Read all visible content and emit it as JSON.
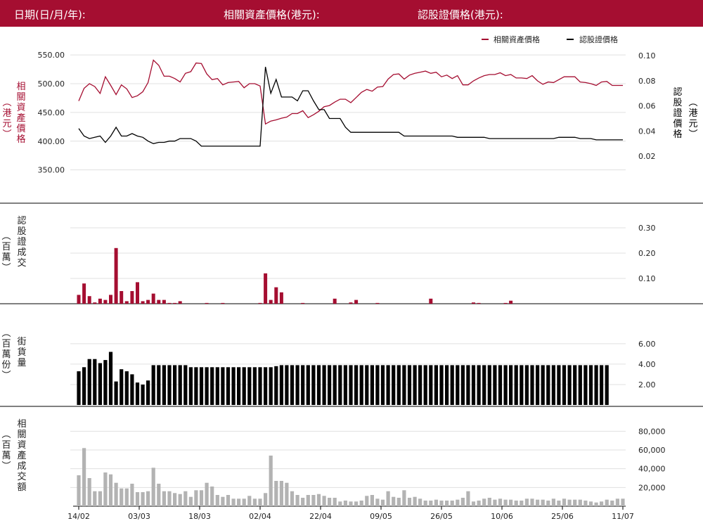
{
  "header": {
    "date_label": "日期(日/月/年):",
    "asset_price_label": "相關資產價格(港元):",
    "warrant_price_label": "認股證價格(港元):"
  },
  "colors": {
    "brand": "#a50e31",
    "warrant": "#000000",
    "turnover_grey": "#b3b3b3",
    "grid": "#e0e0e0"
  },
  "chart_data": [
    {
      "type": "line",
      "legend": [
        "相關資產價格",
        "認股證價格"
      ],
      "legend_position": "top-right",
      "x_ticks": [
        "14/02",
        "03/03",
        "18/03",
        "02/04",
        "22/04",
        "09/05",
        "26/05",
        "10/06",
        "25/06",
        "11/07"
      ],
      "ylabel_left": "相關資產價格(港元)",
      "ylabel_right": "認股證價格(港元)",
      "y_left_ticks": [
        "550.00",
        "500.00",
        "450.00",
        "400.00",
        "350.00"
      ],
      "y_right_ticks": [
        "0.10",
        "0.08",
        "0.06",
        "0.04",
        "0.02"
      ],
      "ylim_left": [
        330,
        560
      ],
      "ylim_right": [
        0,
        0.105
      ],
      "series": [
        {
          "name": "相關資產價格",
          "axis": "left",
          "color": "#a50e31",
          "values": [
            470,
            492,
            500,
            495,
            483,
            512,
            497,
            481,
            498,
            491,
            476,
            479,
            486,
            502,
            541,
            532,
            513,
            513,
            509,
            503,
            518,
            521,
            536,
            535,
            517,
            507,
            509,
            498,
            502,
            503,
            504,
            493,
            500,
            500,
            496,
            430,
            435,
            437,
            440,
            442,
            448,
            448,
            453,
            441,
            446,
            452,
            460,
            462,
            468,
            473,
            473,
            467,
            476,
            485,
            490,
            487,
            494,
            495,
            508,
            516,
            517,
            508,
            515,
            518,
            520,
            522,
            518,
            520,
            512,
            515,
            509,
            514,
            498,
            498,
            505,
            510,
            514,
            516,
            516,
            519,
            514,
            516,
            510,
            510,
            509,
            514,
            505,
            499,
            503,
            502,
            507,
            512,
            512,
            512,
            503,
            502,
            500,
            497,
            503,
            504,
            497,
            497,
            497
          ]
        },
        {
          "name": "認股證價格",
          "axis": "right",
          "color": "#000000",
          "values": [
            0.042,
            0.036,
            0.034,
            0.035,
            0.036,
            0.031,
            0.036,
            0.043,
            0.036,
            0.036,
            0.038,
            0.036,
            0.035,
            0.032,
            0.03,
            0.031,
            0.031,
            0.032,
            0.032,
            0.034,
            0.034,
            0.034,
            0.032,
            0.028,
            0.028,
            0.028,
            0.028,
            0.028,
            0.028,
            0.028,
            0.028,
            0.028,
            0.028,
            0.028,
            0.028,
            0.091,
            0.07,
            0.081,
            0.067,
            0.067,
            0.067,
            0.064,
            0.072,
            0.072,
            0.064,
            0.057,
            0.057,
            0.05,
            0.05,
            0.05,
            0.043,
            0.039,
            0.039,
            0.039,
            0.039,
            0.039,
            0.039,
            0.039,
            0.039,
            0.039,
            0.039,
            0.036,
            0.036,
            0.036,
            0.036,
            0.036,
            0.036,
            0.036,
            0.036,
            0.036,
            0.036,
            0.035,
            0.035,
            0.035,
            0.035,
            0.035,
            0.035,
            0.034,
            0.034,
            0.034,
            0.034,
            0.034,
            0.034,
            0.034,
            0.034,
            0.034,
            0.034,
            0.034,
            0.034,
            0.034,
            0.035,
            0.035,
            0.035,
            0.035,
            0.034,
            0.034,
            0.034,
            0.033,
            0.033,
            0.033,
            0.033,
            0.033,
            0.033
          ]
        }
      ]
    },
    {
      "type": "bar",
      "ylabel": "認股證成交(百萬)",
      "y_ticks": [
        "0.30",
        "0.20",
        "0.10"
      ],
      "ylim": [
        0,
        0.3
      ],
      "color": "#a50e31",
      "values": [
        0.035,
        0.08,
        0.03,
        0.005,
        0.02,
        0.015,
        0.035,
        0.22,
        0.05,
        0.01,
        0.05,
        0.085,
        0.01,
        0.015,
        0.04,
        0.015,
        0.015,
        0.003,
        0.003,
        0.01,
        0,
        0,
        0,
        0,
        0.003,
        0,
        0,
        0.003,
        0,
        0,
        0,
        0,
        0,
        0,
        0.003,
        0.12,
        0.015,
        0.065,
        0.045,
        0,
        0,
        0,
        0.003,
        0,
        0,
        0,
        0,
        0,
        0.02,
        0,
        0,
        0.005,
        0.015,
        0,
        0,
        0,
        0.003,
        0,
        0,
        0,
        0,
        0,
        0,
        0,
        0,
        0,
        0.02,
        0,
        0,
        0,
        0,
        0,
        0,
        0,
        0.005,
        0.003,
        0,
        0,
        0,
        0,
        0.003,
        0.012,
        0,
        0,
        0,
        0,
        0,
        0,
        0,
        0,
        0,
        0,
        0,
        0,
        0,
        0,
        0,
        0,
        0,
        0,
        0
      ]
    },
    {
      "type": "bar",
      "ylabel": "街貨量(百萬份)",
      "y_ticks": [
        "6.00",
        "4.00",
        "2.00"
      ],
      "ylim": [
        0,
        7.3
      ],
      "color": "#000000",
      "values": [
        3.3,
        3.7,
        4.5,
        4.5,
        4.1,
        4.4,
        5.2,
        2.3,
        3.5,
        3.3,
        3.0,
        2.2,
        2.0,
        2.4,
        3.9,
        3.9,
        3.9,
        3.9,
        3.9,
        3.9,
        3.9,
        3.7,
        3.7,
        3.7,
        3.7,
        3.7,
        3.7,
        3.7,
        3.7,
        3.7,
        3.7,
        3.7,
        3.7,
        3.7,
        3.7,
        3.7,
        3.7,
        3.8,
        3.9,
        3.9,
        3.9,
        3.9,
        3.9,
        3.9,
        3.9,
        3.9,
        3.9,
        3.9,
        3.9,
        3.9,
        3.9,
        3.9,
        3.9,
        3.9,
        3.9,
        3.9,
        3.9,
        3.9,
        3.9,
        3.9,
        3.9,
        3.9,
        3.9,
        3.9,
        3.9,
        3.9,
        3.9,
        3.9,
        3.9,
        3.9,
        3.9,
        3.9,
        3.9,
        3.9,
        3.9,
        3.9,
        3.9,
        3.9,
        3.9,
        3.9,
        3.9,
        3.9,
        3.9,
        3.9,
        3.9,
        3.9,
        3.9,
        3.9,
        3.9,
        3.9,
        3.9,
        3.9,
        3.9,
        3.9,
        3.9,
        3.9,
        3.9,
        3.9,
        3.9,
        3.9
      ]
    },
    {
      "type": "bar",
      "ylabel": "相關資產成交額(百萬)",
      "y_ticks": [
        "80,000",
        "60,000",
        "40,000",
        "20,000"
      ],
      "ylim": [
        0,
        90000
      ],
      "color": "#b3b3b3",
      "values": [
        33000,
        62000,
        30000,
        16000,
        16000,
        36000,
        34000,
        25000,
        19000,
        19000,
        24000,
        15000,
        15000,
        16000,
        41000,
        24000,
        16000,
        16000,
        14000,
        13000,
        16000,
        10000,
        17000,
        17000,
        25000,
        21000,
        12000,
        10000,
        12000,
        8000,
        8000,
        8000,
        11000,
        8000,
        8000,
        14000,
        54000,
        27000,
        27000,
        25000,
        16000,
        12000,
        9000,
        12000,
        12000,
        13000,
        11000,
        9000,
        9000,
        5000,
        6000,
        5000,
        5000,
        6000,
        11000,
        12000,
        8000,
        7000,
        16000,
        10000,
        9000,
        17000,
        9000,
        10000,
        8000,
        6000,
        6000,
        7000,
        6000,
        6000,
        6000,
        7000,
        9000,
        16000,
        5000,
        6000,
        8000,
        9000,
        7000,
        8000,
        7000,
        7000,
        6000,
        6000,
        8000,
        8000,
        7000,
        7000,
        6000,
        8000,
        6000,
        8000,
        7000,
        7000,
        7000,
        6000,
        5000,
        4000,
        5000,
        7000,
        6000,
        8000,
        8000
      ]
    }
  ]
}
